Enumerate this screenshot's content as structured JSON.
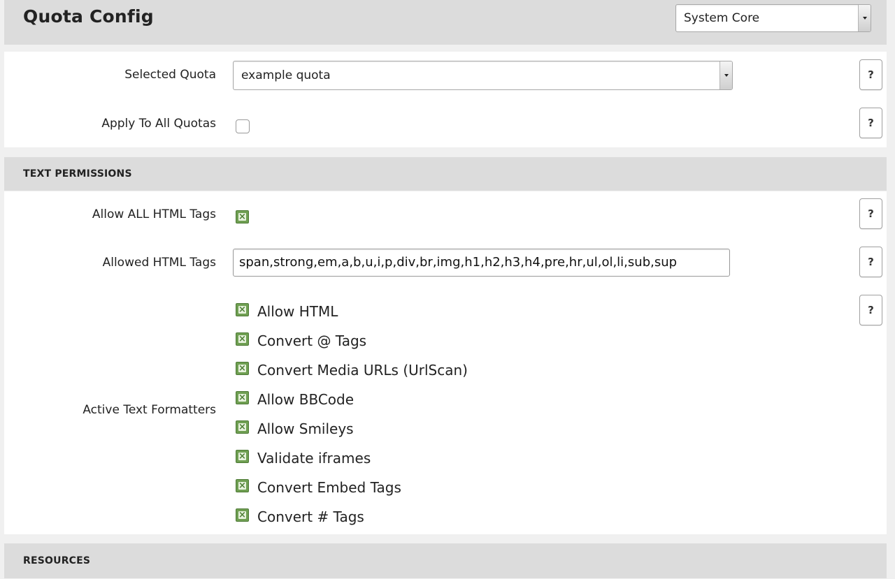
{
  "header": {
    "title": "Quota Config",
    "module_select": "System Core"
  },
  "quota": {
    "selected_label": "Selected Quota",
    "selected_value": "example quota",
    "apply_all_label": "Apply To All Quotas",
    "apply_all_checked": false
  },
  "text_permissions": {
    "section_title": "TEXT PERMISSIONS",
    "allow_all_label": "Allow ALL HTML Tags",
    "allow_all_checked": true,
    "allowed_tags_label": "Allowed HTML Tags",
    "allowed_tags_value": "span,strong,em,a,b,u,i,p,div,br,img,h1,h2,h3,h4,pre,hr,ul,ol,li,sub,sup",
    "formatters_label": "Active Text Formatters",
    "formatters": [
      {
        "label": "Allow HTML",
        "checked": true
      },
      {
        "label": "Convert @ Tags",
        "checked": true
      },
      {
        "label": "Convert Media URLs (UrlScan)",
        "checked": true
      },
      {
        "label": "Allow BBCode",
        "checked": true
      },
      {
        "label": "Allow Smileys",
        "checked": true
      },
      {
        "label": "Validate iframes",
        "checked": true
      },
      {
        "label": "Convert Embed Tags",
        "checked": true
      },
      {
        "label": "Convert # Tags",
        "checked": true
      }
    ]
  },
  "resources": {
    "section_title": "RESOURCES"
  },
  "help": {
    "label": "?"
  },
  "icons": {
    "select_arrow": "chevron-down-icon",
    "checked_box": "checkbox-checked-icon"
  },
  "colors": {
    "section_bg": "#dcdcdc",
    "checkbox_green": "#6f9f52"
  }
}
